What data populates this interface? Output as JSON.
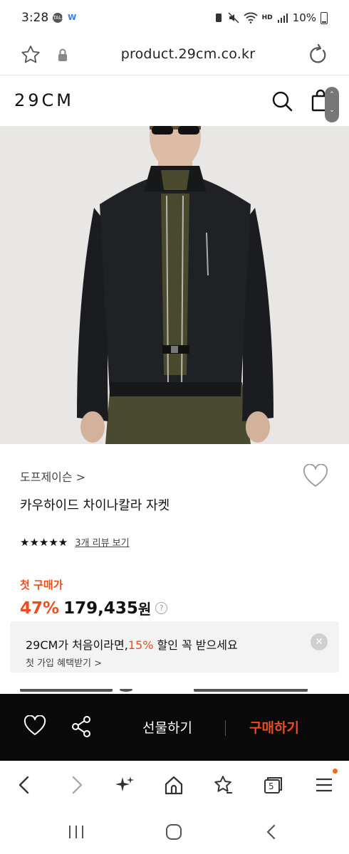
{
  "status": {
    "time": "3:28",
    "talk_badge": "TALK",
    "hd_label": "HD",
    "battery": "10%"
  },
  "browser": {
    "url": "product.29cm.co.kr"
  },
  "site": {
    "logo": "29CM"
  },
  "product": {
    "brand": "도프제이슨 >",
    "name": "카우하이드 차이나칼라 자켓",
    "stars": "★★★★★",
    "review_link": "3개 리뷰 보기",
    "price_label": "첫 구매가",
    "discount": "47%",
    "price": "179,435",
    "price_unit": "원",
    "help_glyph": "?"
  },
  "banner": {
    "line1_prefix": "29CM가 처음이라면,",
    "line1_pct": "15%",
    "line1_suffix": " 할인 꼭 받으세요",
    "line2": "첫 가입 혜택받기 >",
    "close_glyph": "✕"
  },
  "actionbar": {
    "gift_label": "선물하기",
    "buy_label": "구매하기"
  },
  "browsernav": {
    "tabs_count": "5"
  },
  "colors": {
    "accent": "#f04a1d",
    "actionbar_bg": "#0a0a0a",
    "banner_bg": "#f3f3f3"
  },
  "icons": [
    "star-icon",
    "lock-icon",
    "reload-icon",
    "search-icon",
    "shopping-bag-icon",
    "heart-icon",
    "share-icon",
    "back-icon",
    "forward-icon",
    "sparkle-icon",
    "home-icon",
    "bookmark-star-icon",
    "tabs-icon",
    "menu-icon",
    "recents-icon",
    "home-circle-icon",
    "system-back-icon"
  ]
}
